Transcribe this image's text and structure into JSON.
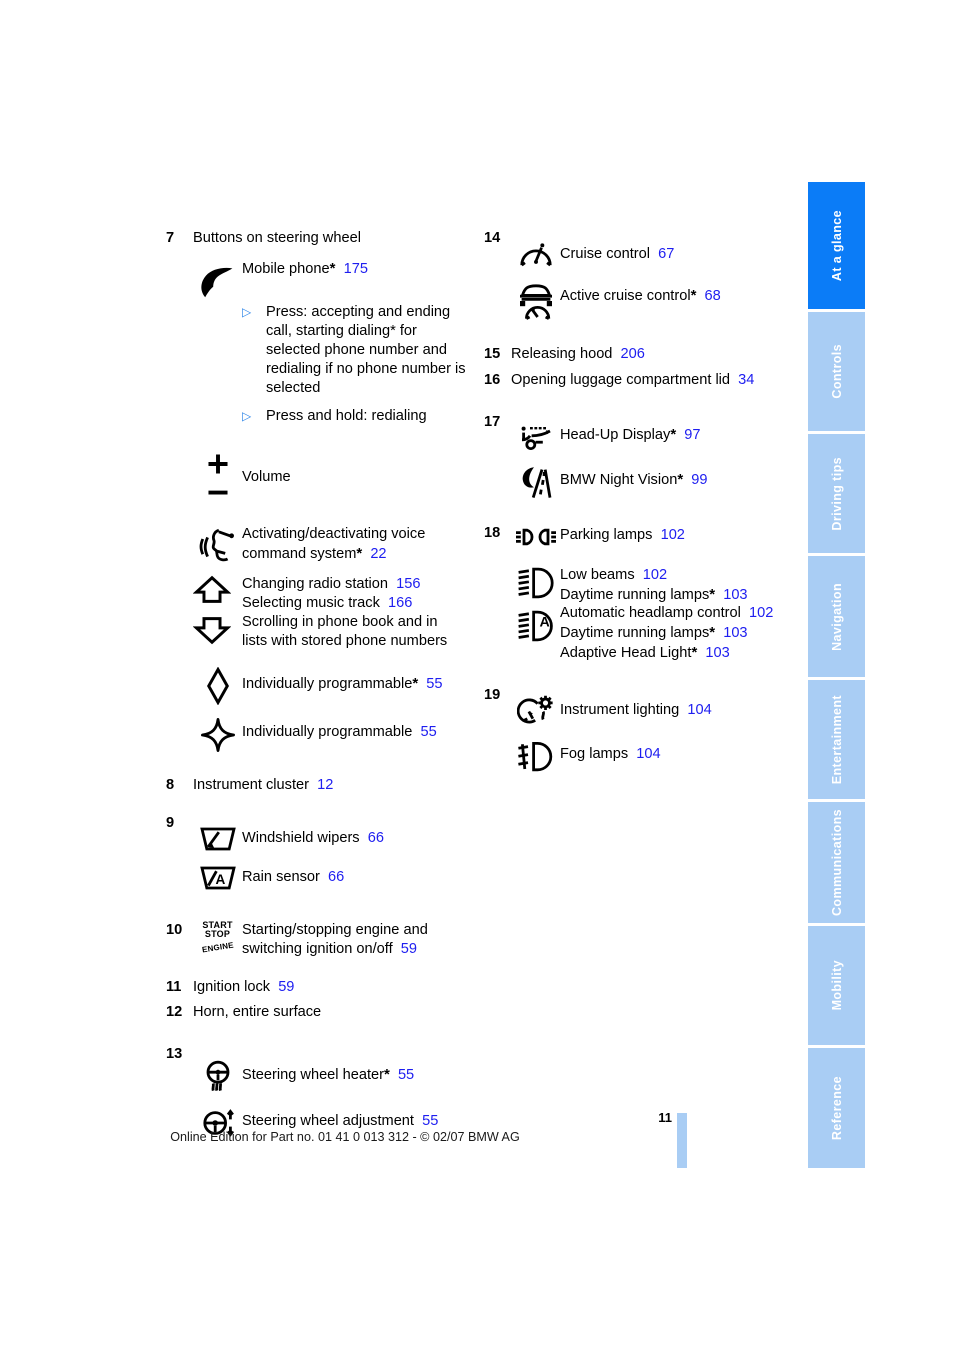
{
  "document": {
    "page_number": "11",
    "footer": "Online Edition for Part no. 01 41 0 013 312 - © 02/07 BMW AG",
    "accent_blue": "#1e1ef0",
    "tab_active_color": "#0b7cf7",
    "tab_inactive_color": "#a9cdf4"
  },
  "tabs": [
    {
      "label": "At a glance",
      "active": true
    },
    {
      "label": "Controls",
      "active": false
    },
    {
      "label": "Driving tips",
      "active": false
    },
    {
      "label": "Navigation",
      "active": false
    },
    {
      "label": "Entertainment",
      "active": false
    },
    {
      "label": "Communications",
      "active": false
    },
    {
      "label": "Mobility",
      "active": false
    },
    {
      "label": "Reference",
      "active": false
    }
  ],
  "left_column": {
    "item7": {
      "number": "7",
      "heading": "Buttons on steering wheel",
      "mobile_phone": {
        "label": "Mobile phone",
        "star": "*",
        "page": "175"
      },
      "bullet1": "Press: accepting and ending call, starting dialing* for selected phone number and redialing if no phone number is selected",
      "bullet2": "Press and hold: redialing",
      "volume": "Volume",
      "voice": {
        "label": "Activating/deactivating voice command system",
        "star": "*",
        "page": "22"
      },
      "radio": {
        "label": "Changing radio station",
        "page": "156"
      },
      "music": {
        "label": "Selecting music track",
        "page": "166"
      },
      "scroll": "Scrolling in phone book and in lists with stored phone numbers",
      "prog1": {
        "label": "Individually programmable",
        "star": "*",
        "page": "55"
      },
      "prog2": {
        "label": "Individually programmable",
        "page": "55"
      }
    },
    "item8": {
      "number": "8",
      "label": "Instrument cluster",
      "page": "12"
    },
    "item9": {
      "number": "9",
      "wipers": {
        "label": "Windshield wipers",
        "page": "66"
      },
      "rain": {
        "label": "Rain sensor",
        "page": "66"
      }
    },
    "item10": {
      "number": "10",
      "icon_line1": "START",
      "icon_line2": "STOP",
      "icon_line3": "ENGINE",
      "label": "Starting/stopping engine and switching ignition on/off",
      "page": "59"
    },
    "item11": {
      "number": "11",
      "label": "Ignition lock",
      "page": "59"
    },
    "item12": {
      "number": "12",
      "label": "Horn, entire surface"
    },
    "item13": {
      "number": "13",
      "heater": {
        "label": "Steering wheel heater",
        "star": "*",
        "page": "55"
      },
      "adjust": {
        "label": "Steering wheel adjustment",
        "page": "55"
      }
    }
  },
  "right_column": {
    "item14": {
      "number": "14",
      "cruise": {
        "label": "Cruise control",
        "page": "67"
      },
      "active_cruise": {
        "label": "Active cruise control",
        "star": "*",
        "page": "68"
      }
    },
    "item15": {
      "number": "15",
      "label": "Releasing hood",
      "page": "206"
    },
    "item16": {
      "number": "16",
      "label": "Opening luggage compartment lid",
      "page": "34"
    },
    "item17": {
      "number": "17",
      "hud": {
        "label": "Head-Up Display",
        "star": "*",
        "page": "97"
      },
      "night_vision": {
        "label": "BMW Night Vision",
        "star": "*",
        "page": "99"
      }
    },
    "item18": {
      "number": "18",
      "parking": {
        "label": "Parking lamps",
        "page": "102"
      },
      "low_beams": {
        "label": "Low beams",
        "page": "102"
      },
      "drl1": {
        "label": "Daytime running lamps",
        "star": "*",
        "page": "103"
      },
      "auto_headlamp": {
        "label": "Automatic headlamp control",
        "page": "102"
      },
      "drl2": {
        "label": "Daytime running lamps",
        "star": "*",
        "page": "103"
      },
      "adaptive": {
        "label": "Adaptive Head Light",
        "star": "*",
        "page": "103"
      }
    },
    "item19": {
      "number": "19",
      "instrument_lighting": {
        "label": "Instrument lighting",
        "page": "104"
      },
      "fog": {
        "label": "Fog lamps",
        "page": "104"
      }
    }
  }
}
